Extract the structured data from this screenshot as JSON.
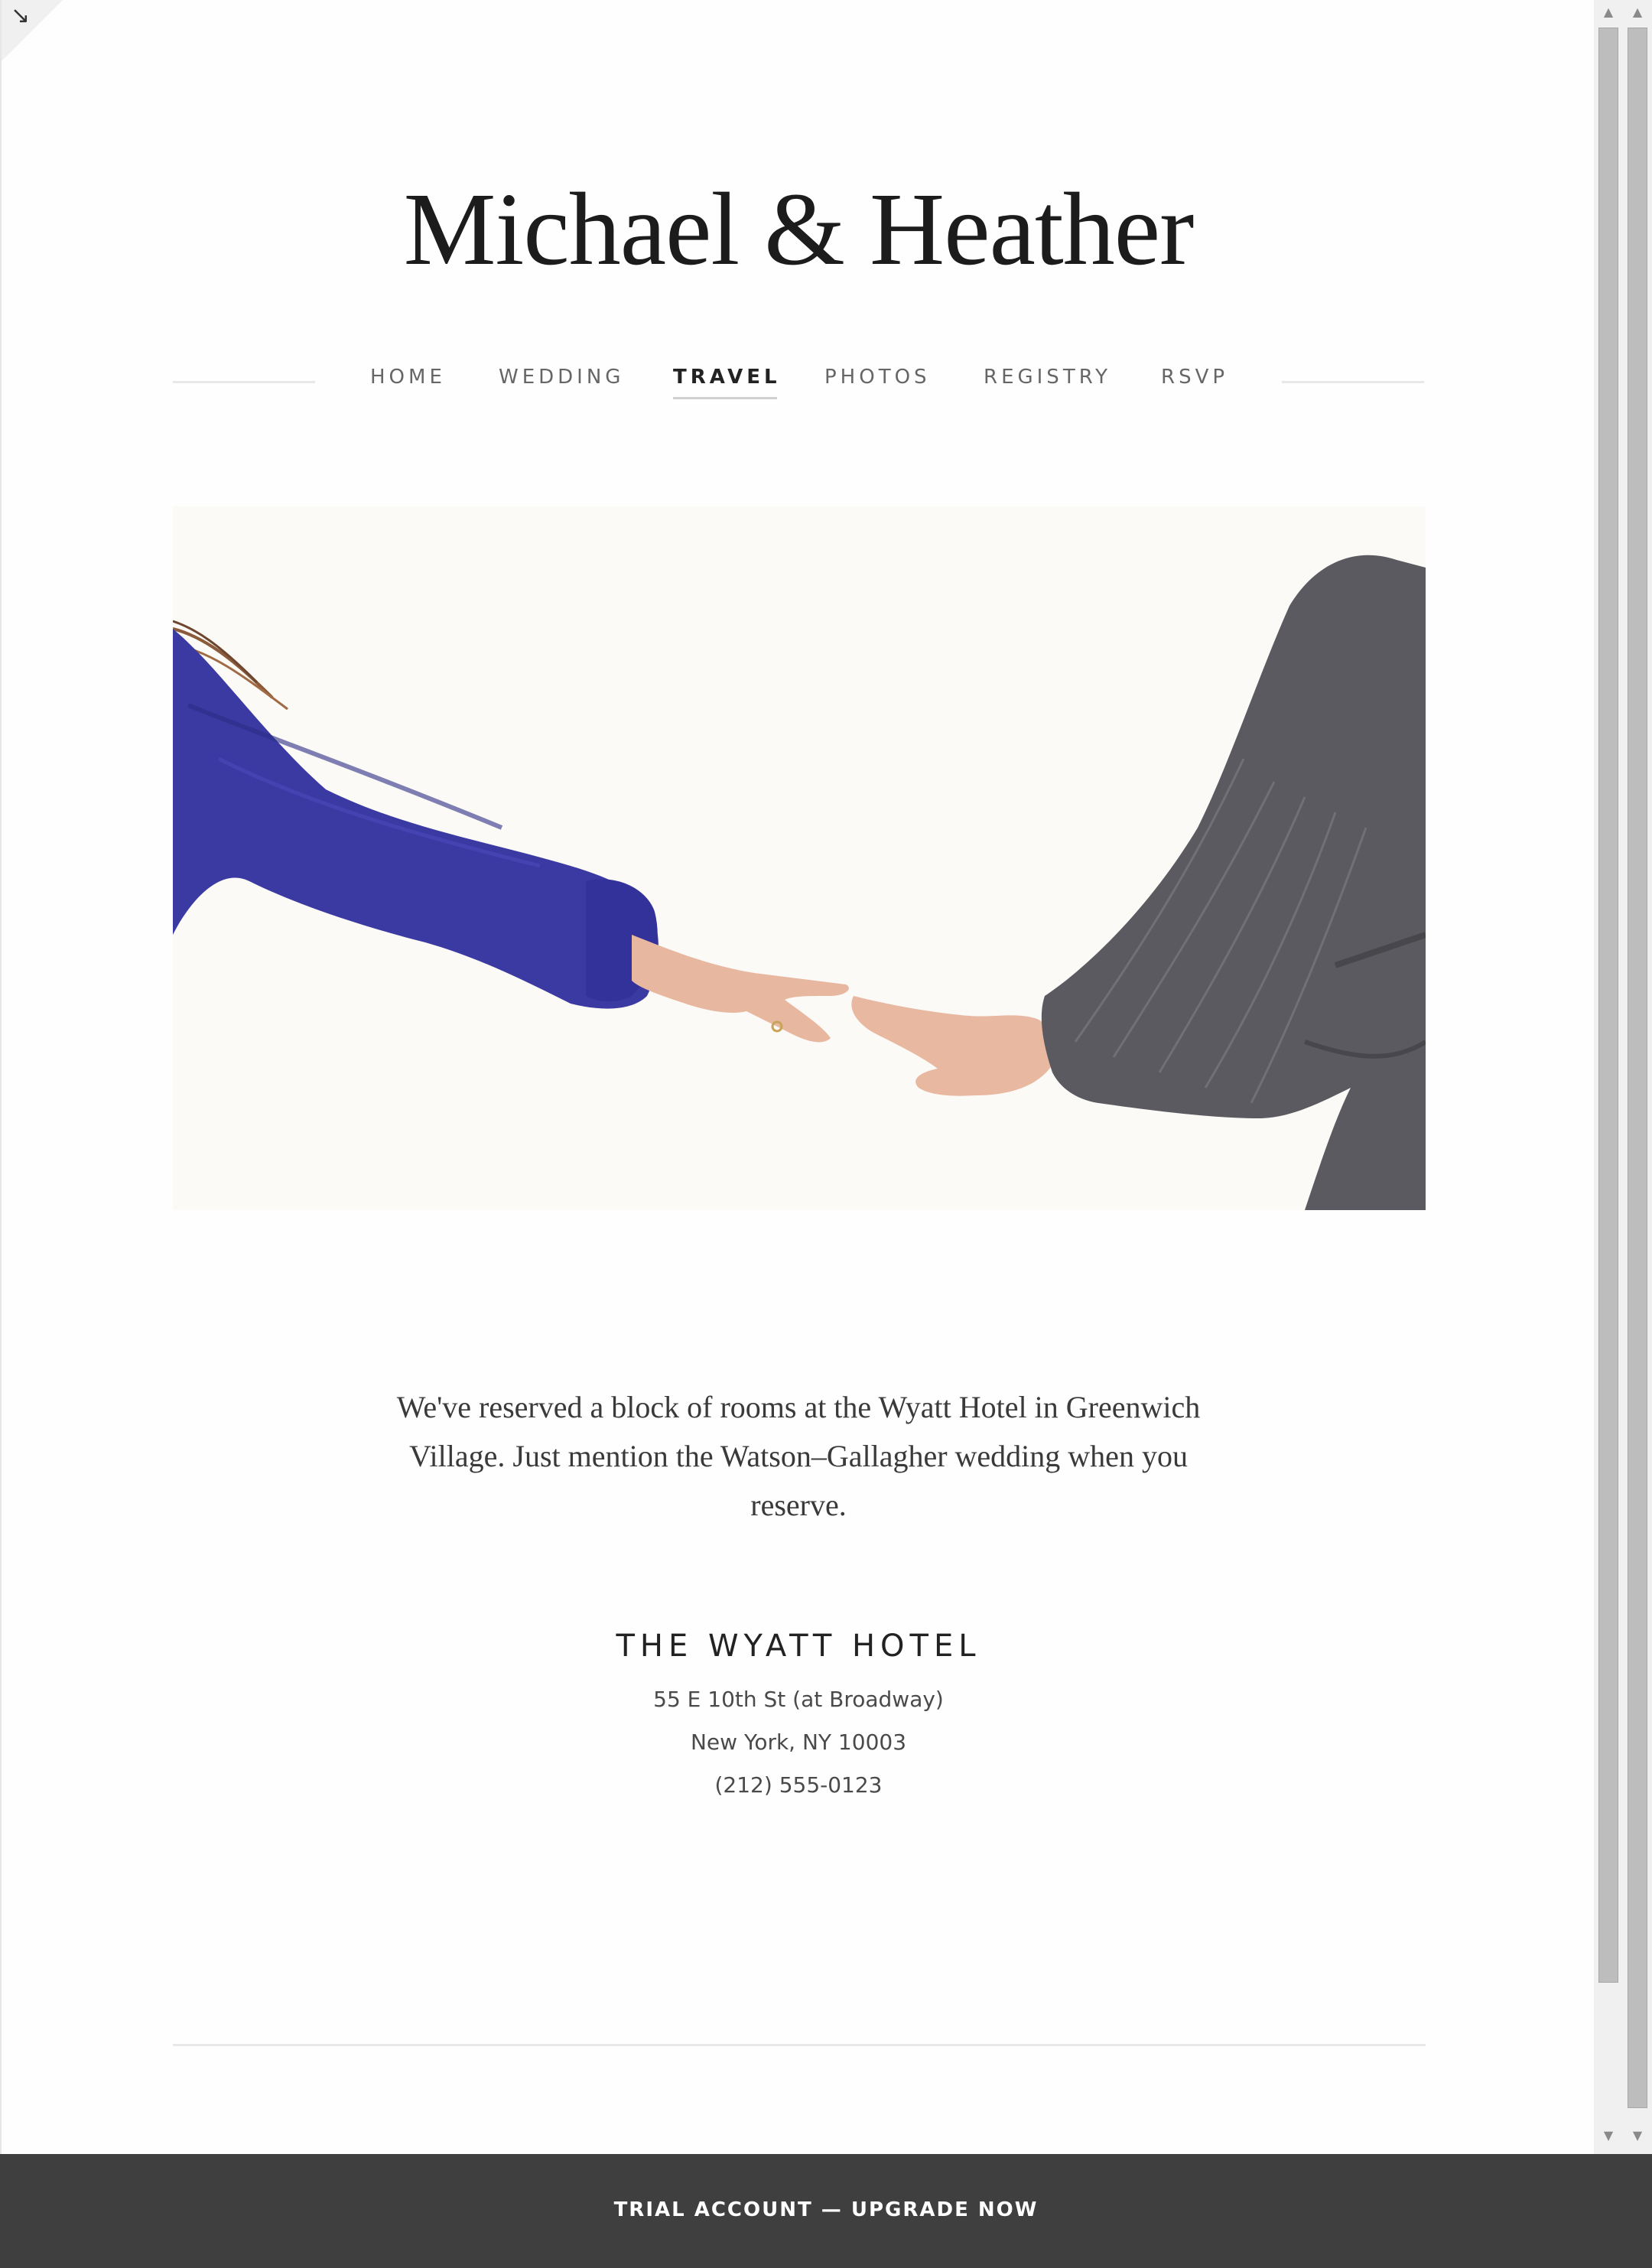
{
  "site": {
    "title": "Michael & Heather"
  },
  "nav": {
    "items": [
      {
        "label": "HOME"
      },
      {
        "label": "WEDDING"
      },
      {
        "label": "TRAVEL"
      },
      {
        "label": "PHOTOS"
      },
      {
        "label": "REGISTRY"
      },
      {
        "label": "RSVP"
      }
    ],
    "active": "TRAVEL"
  },
  "hero": {
    "image_description": "hands-reaching-photo"
  },
  "content": {
    "intro": "We've reserved a block of rooms at the Wyatt Hotel in Greenwich Village. Just mention the Watson–Gallagher wedding when you reserve.",
    "hotel": {
      "name": "THE WYATT HOTEL",
      "address_line1": "55 E 10th St (at Broadway)",
      "address_line2": "New York, NY 10003",
      "phone": "(212) 555-0123"
    }
  },
  "footer": {
    "trial_banner": "TRIAL ACCOUNT — UPGRADE NOW"
  },
  "icons": {
    "corner": "resize-arrow-icon",
    "scroll_up": "scroll-up-arrow-icon",
    "scroll_down": "scroll-down-arrow-icon"
  },
  "colors": {
    "background": "#fefefe",
    "text_dark": "#1c1c1c",
    "nav_text": "#666666",
    "trial_bar": "#3f3f3f",
    "sleeve_blue": "#3a3a9e",
    "suit_gray": "#5a5a5e",
    "hero_bg": "#fbfaf6"
  }
}
